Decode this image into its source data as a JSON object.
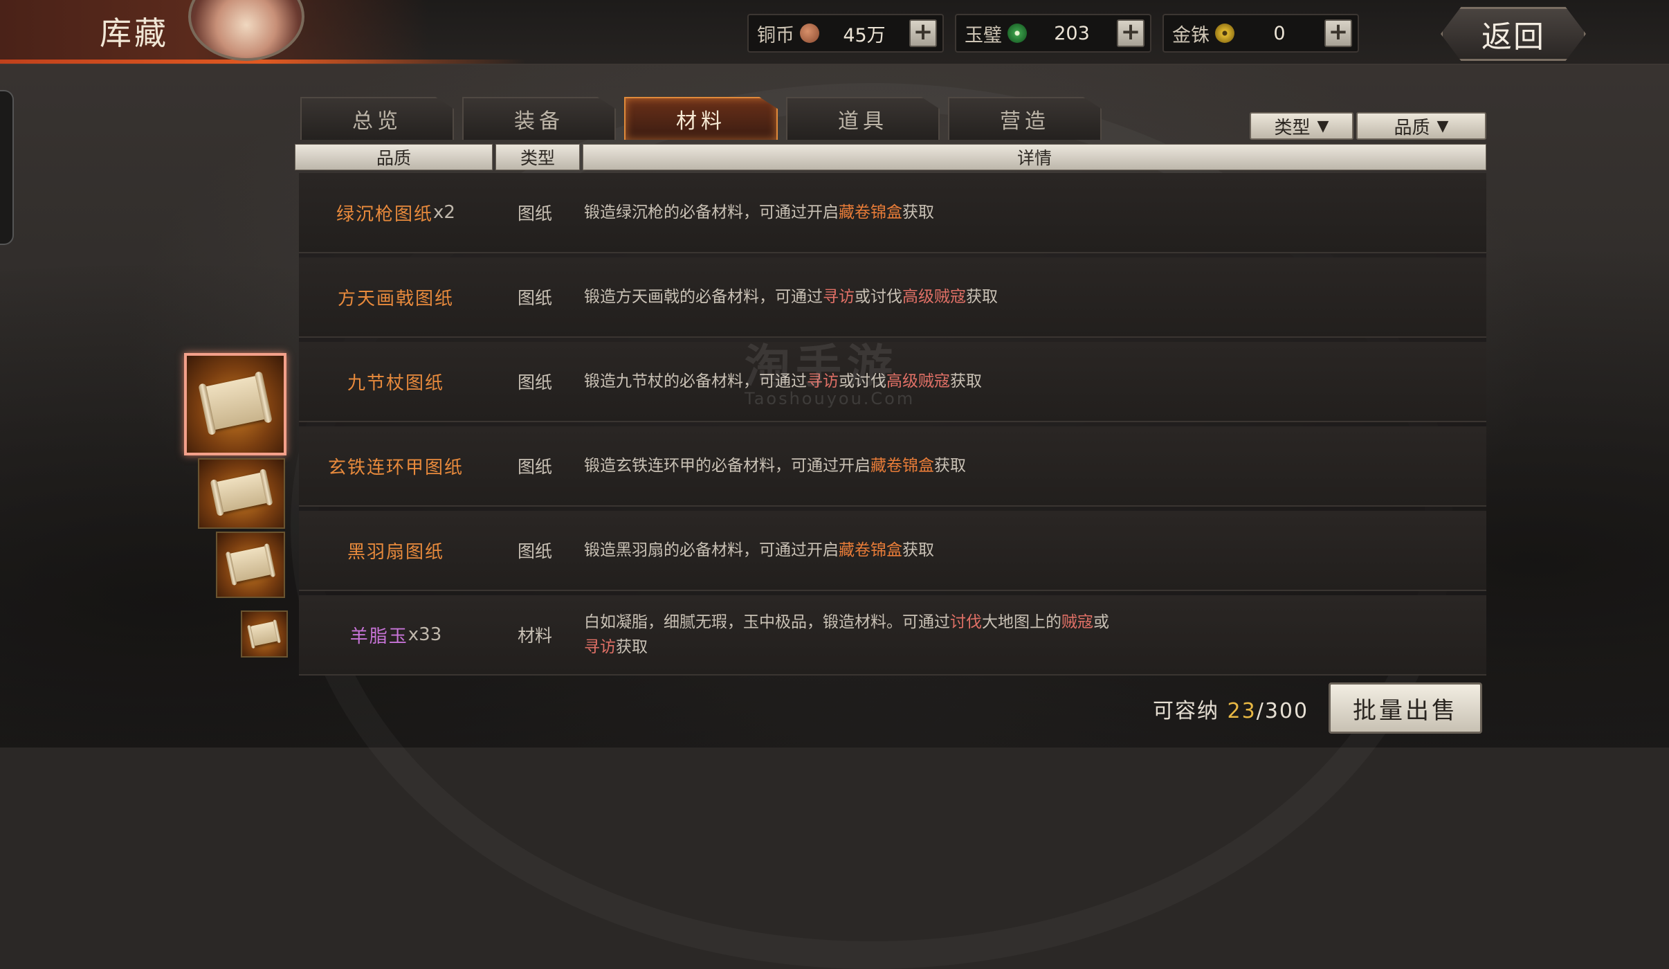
{
  "header": {
    "title": "库藏",
    "back_label": "返回",
    "currencies": [
      {
        "name": "铜币",
        "value": "45万",
        "icon": "copper-coin-icon"
      },
      {
        "name": "玉璧",
        "value": "203",
        "icon": "jade-disc-icon"
      },
      {
        "name": "金铢",
        "value": "0",
        "icon": "gold-coin-icon"
      }
    ],
    "plus_symbol": "+"
  },
  "tabs": [
    {
      "label": "总览",
      "active": false
    },
    {
      "label": "装备",
      "active": false
    },
    {
      "label": "材料",
      "active": true
    },
    {
      "label": "道具",
      "active": false
    },
    {
      "label": "营造",
      "active": false
    }
  ],
  "filters": {
    "type_label": "类型",
    "quality_label": "品质",
    "arrow": "▼"
  },
  "columns": {
    "quality": "品质",
    "type": "类型",
    "detail": "详情"
  },
  "items": [
    {
      "name": "绿沉枪图纸",
      "qty": "x2",
      "type": "图纸",
      "d1": "锻造绿沉枪的必备材料，可通过开启",
      "h1": "藏卷锦盒",
      "d2": "获取",
      "h2": "",
      "d3": "",
      "h3": "",
      "d4": ""
    },
    {
      "name": "方天画戟图纸",
      "qty": "",
      "type": "图纸",
      "d1": "锻造方天画戟的必备材料，可通过",
      "h1": "寻访",
      "d2": "或讨伐",
      "h2": "高级贼寇",
      "d3": "获取",
      "h3": "",
      "d4": ""
    },
    {
      "name": "九节杖图纸",
      "qty": "",
      "type": "图纸",
      "d1": "锻造九节杖的必备材料，可通过",
      "h1": "寻访",
      "d2": "或讨伐",
      "h2": "高级贼寇",
      "d3": "获取",
      "h3": "",
      "d4": ""
    },
    {
      "name": "玄铁连环甲图纸",
      "qty": "",
      "type": "图纸",
      "d1": "锻造玄铁连环甲的必备材料，可通过开启",
      "h1": "藏卷锦盒",
      "d2": "获取",
      "h2": "",
      "d3": "",
      "h3": "",
      "d4": ""
    },
    {
      "name": "黑羽扇图纸",
      "qty": "",
      "type": "图纸",
      "d1": "锻造黑羽扇的必备材料，可通过开启",
      "h1": "藏卷锦盒",
      "d2": "获取",
      "h2": "",
      "d3": "",
      "h3": "",
      "d4": ""
    },
    {
      "name": "羊脂玉",
      "qty": "x33",
      "type": "材料",
      "d1": "白如凝脂，细腻无瑕，玉中极品，锻造材料。可通过",
      "h1": "讨伐",
      "d2": "大地图上的",
      "h2": "贼寇",
      "d3": "或",
      "h3": "寻访",
      "d4": "获取"
    }
  ],
  "watermark": {
    "main": "淘手游",
    "sub": "Taoshouyou.Com"
  },
  "footer": {
    "capacity_label": "可容纳",
    "capacity_current": "23",
    "capacity_sep": "/",
    "capacity_max": "300",
    "sell_label": "批量出售"
  },
  "colors": {
    "accent_orange": "#e88a3c",
    "quality_purple": "#c874d8",
    "highlight_red": "#e07066",
    "active_tab_border": "#e08a3a"
  }
}
